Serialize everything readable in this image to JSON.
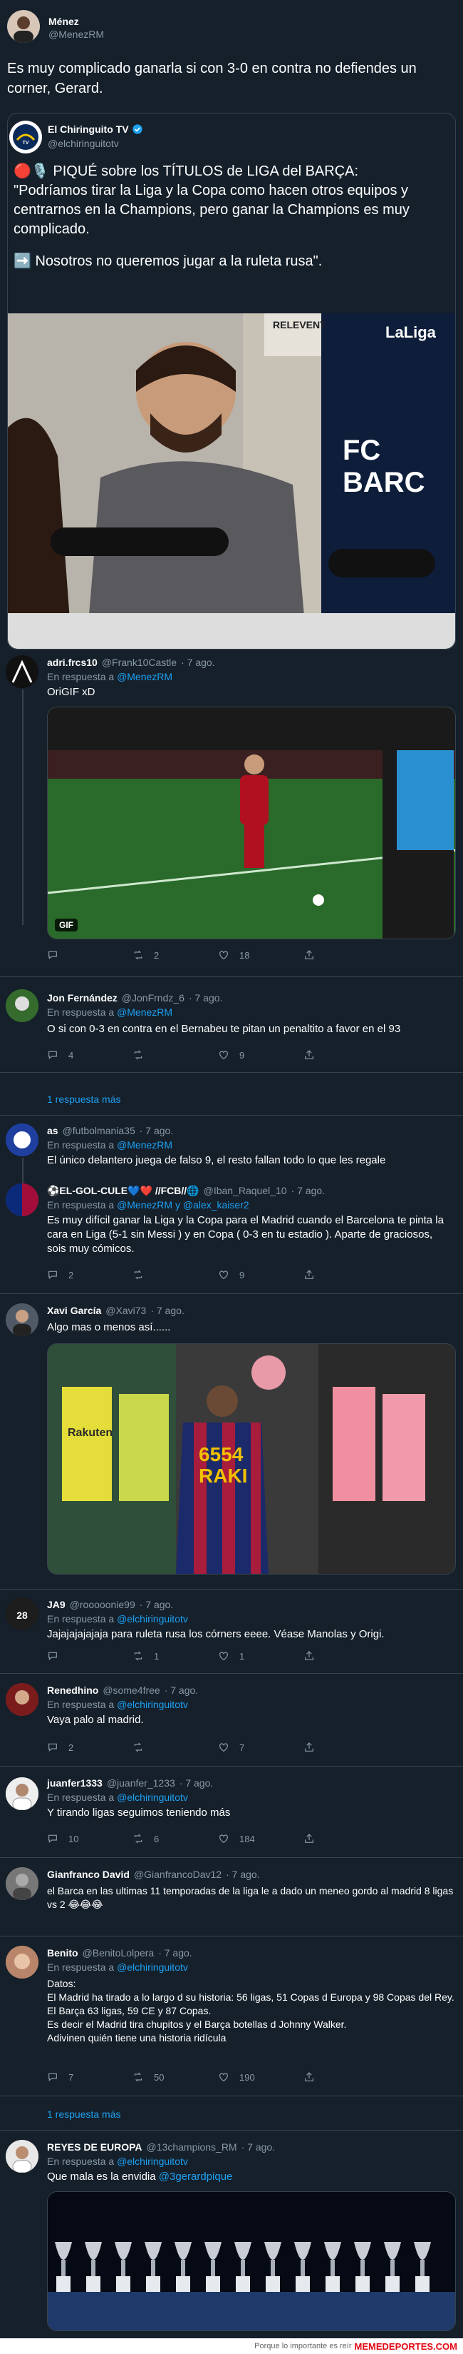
{
  "header": {
    "name": "Ménez",
    "handle": "@MenezRM",
    "text": "Es muy complicado ganarla si con 3-0 en contra no defiendes un corner, Gerard."
  },
  "quoted": {
    "name": "El Chiringuito TV",
    "handle": "@elchiringuitotv",
    "line1": "🔴🎙️ PIQUÉ sobre los TÍTULOS de LIGA del BARÇA:",
    "line2": "\"Podríamos tirar la Liga y la Copa como hacen otros equipos y centrarnos en la Champions, pero ganar la Champions es muy complicado.",
    "line3": "➡️ Nosotros no queremos jugar a la ruleta rusa\".",
    "photo_sign_1": "RELEVENT",
    "photo_sign_2": "LaLiga",
    "photo_sign_3": "FC BARC"
  },
  "replies": [
    {
      "name": "adri.frcs10",
      "handle": "@Frank10Castle",
      "time": "· 7 ago.",
      "reply_prefix": "En respuesta a",
      "reply_to": "@MenezRM",
      "text": "OriGIF xD",
      "gif_label": "GIF",
      "counts": {
        "reply": "",
        "retweet": "2",
        "like": "18"
      }
    },
    {
      "name": "Jon Fernández",
      "handle": "@JonFrndz_6",
      "time": "· 7 ago.",
      "reply_prefix": "En respuesta a",
      "reply_to": "@MenezRM",
      "text": "O si con 0-3 en contra en el Bernabeu te pitan un penaltito a favor en el 93",
      "counts": {
        "reply": "4",
        "retweet": "",
        "like": "9"
      },
      "show_replies": "1 respuesta más"
    },
    {
      "name": "as",
      "handle": "@futbolmania35",
      "time": "· 7 ago.",
      "reply_prefix": "En respuesta a",
      "reply_to": "@MenezRM",
      "text": "El único delantero juega de falso 9, el resto fallan todo lo que les regale"
    },
    {
      "name": "⚽EL-GOL-CULE💙❤️ //FCB//🌐",
      "handle": "@Iban_Raquel_10",
      "time": "· 7 ago.",
      "reply_prefix": "En respuesta a",
      "reply_to": "@MenezRM y @alex_kaiser2",
      "text": "Es muy difícil ganar la Liga y la Copa para el Madrid cuando el Barcelona te pinta la cara en Liga (5-1 sin Messi ) y en Copa ( 0-3 en tu estadio ). Aparte de graciosos, sois muy cómicos.",
      "counts": {
        "reply": "2",
        "retweet": "",
        "like": "9"
      }
    },
    {
      "name": "Xavi García",
      "handle": "@Xavi73",
      "time": "· 7 ago.",
      "text": "Algo mas o menos así......",
      "jersey_text": "6554 RAKI",
      "shop_sign": "Rakuten"
    },
    {
      "name": "JA9",
      "handle": "@rooooonie99",
      "time": "· 7 ago.",
      "reply_prefix": "En respuesta a",
      "reply_to": "@elchiringuitotv",
      "text": "Jajajajajajaja para ruleta rusa los córners eeee. Véase Manolas y Origi.",
      "counts": {
        "reply": "",
        "retweet": "1",
        "like": "1"
      }
    },
    {
      "name": "Renedhino",
      "handle": "@some4free",
      "time": "· 7 ago.",
      "reply_prefix": "En respuesta a",
      "reply_to": "@elchiringuitotv",
      "text": "Vaya palo al madrid.",
      "counts": {
        "reply": "2",
        "retweet": "",
        "like": "7"
      }
    },
    {
      "name": "juanfer1333",
      "handle": "@juanfer_1233",
      "time": "· 7 ago.",
      "reply_prefix": "En respuesta a",
      "reply_to": "@elchiringuitotv",
      "text": "Y tirando ligas seguimos teniendo más",
      "counts": {
        "reply": "10",
        "retweet": "6",
        "like": "184"
      }
    },
    {
      "name": "Gianfranco David",
      "handle": "@GianfrancoDav12",
      "time": "· 7 ago.",
      "text": "el Barca en las ultimas 11 temporadas de la liga le a dado un meneo gordo al madrid 8 ligas vs 2 😂😂😂"
    },
    {
      "name": "Benito",
      "handle": "@BenitoLolpera",
      "time": "· 7 ago.",
      "reply_prefix": "En respuesta a",
      "reply_to": "@elchiringuitotv",
      "lines": [
        "Datos:",
        "El Madrid ha tirado a lo largo d su historia: 56 ligas, 51 Copas d Europa y 98 Copas del Rey.",
        "El Barça 63 ligas, 59 CE y 87 Copas.",
        "Es decir el Madrid tira chupitos y el Barça botellas d Johnny Walker.",
        "Adivinen quién tiene una historia ridícula"
      ],
      "counts": {
        "reply": "7",
        "retweet": "50",
        "like": "190"
      },
      "show_replies": "1 respuesta más"
    },
    {
      "name": "REYES DE EUROPA",
      "handle": "@13champions_RM",
      "time": "· 7 ago.",
      "reply_prefix": "En respuesta a",
      "reply_to": "@elchiringuitotv",
      "text_prefix": "Que mala es la envidia",
      "text_mention": "@3gerardpique"
    }
  ],
  "footer": {
    "small": "Porque lo importante es reír",
    "brand": "MEMEDEPORTES.COM"
  },
  "colors": {
    "bg": "#15202b",
    "accent": "#1da1f2",
    "muted": "#8899a6",
    "divider": "#38444d"
  }
}
